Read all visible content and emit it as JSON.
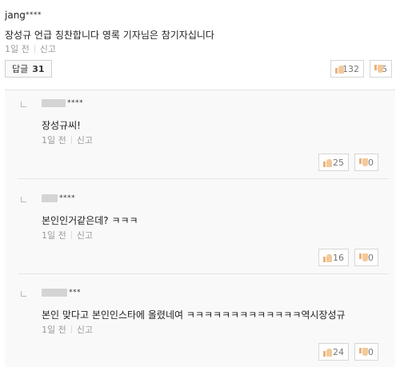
{
  "comment": {
    "author_prefix": "jang",
    "author_mask": "****",
    "text": "장성규 언급 칭찬합니다 영록 기자님은 참기자십니다",
    "time": "1일 전",
    "report": "신고",
    "reply_label": "답글",
    "reply_count": "31",
    "likes": "132",
    "dislikes": "5"
  },
  "replies": [
    {
      "author_mask": "****",
      "text": "장성규씨!",
      "time": "1일 전",
      "report": "신고",
      "likes": "25",
      "dislikes": "0"
    },
    {
      "author_mask": "****",
      "text": "본인인거같은데? ㅋㅋㅋ",
      "time": "1일 전",
      "report": "신고",
      "likes": "16",
      "dislikes": "0"
    },
    {
      "author_mask": "***",
      "text": "본인 맞다고 본인인스타에 올렸네여 ㅋㅋㅋㅋㅋㅋㅋㅋㅋㅋㅋㅋㅋ역시장성규",
      "time": "1일 전",
      "report": "신고",
      "likes": "24",
      "dislikes": "0"
    }
  ],
  "icons": {
    "like": "thumbs-up-icon",
    "dislike": "thumbs-down-icon"
  },
  "colors": {
    "reply_area_bg": "#f9f9f9",
    "thumb": "#f3c999",
    "meta_text": "#9a9a9a"
  }
}
